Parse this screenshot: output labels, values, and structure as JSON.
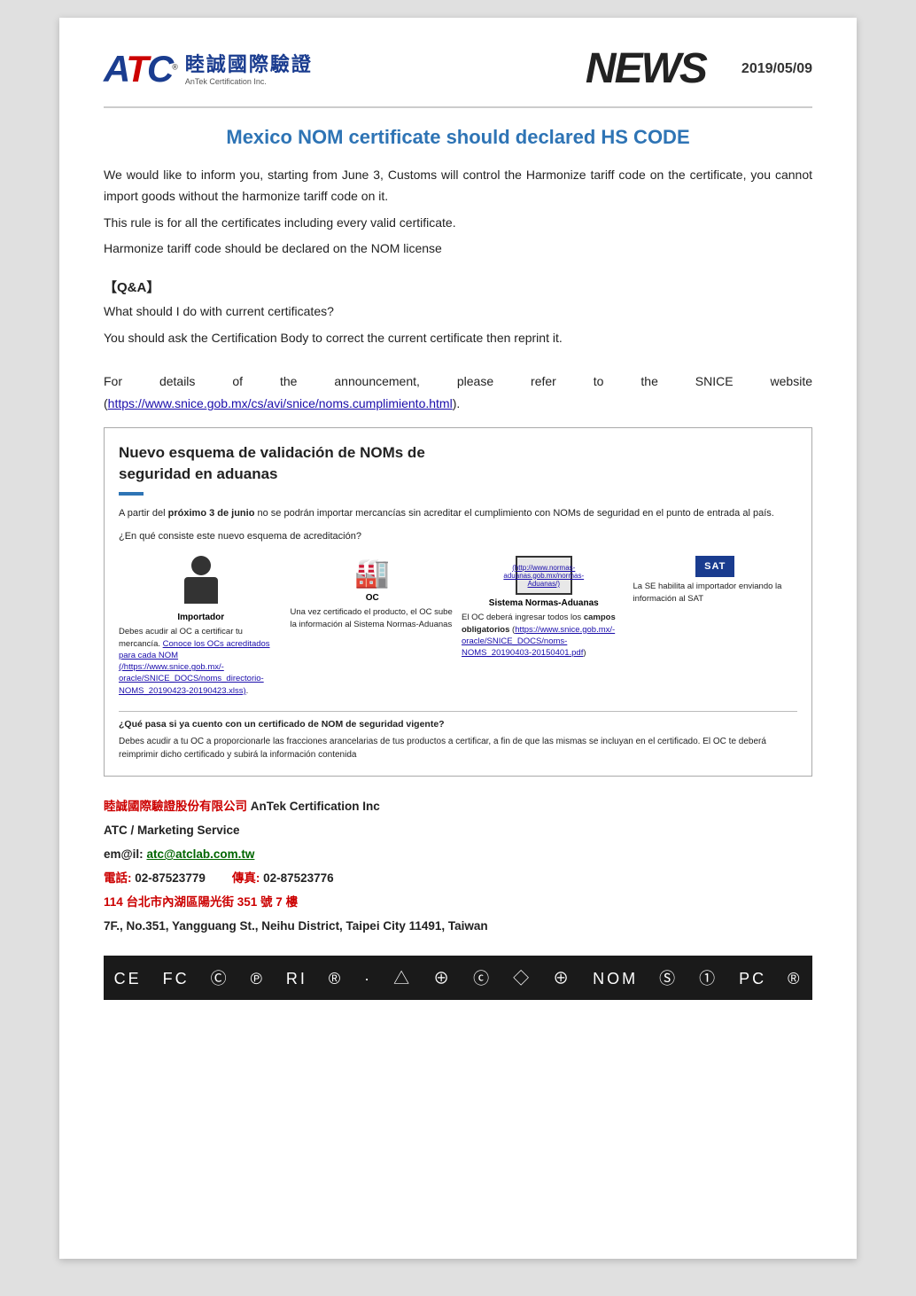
{
  "header": {
    "logo_atc": "ATC",
    "logo_cn": "睦誠國際驗證",
    "logo_sub": "AnTek Certification Inc.",
    "news": "NEWS",
    "date": "2019/05/09"
  },
  "main_title": "Mexico NOM certificate should declared HS CODE",
  "body": {
    "para1": "We would like to inform you, starting from June 3, Customs will control the Harmonize tariff code on the certificate, you cannot import goods without the harmonize tariff code on it.",
    "para2": "This rule is for all the certificates including every valid certificate.",
    "para3": "Harmonize tariff code should be declared on the NOM license",
    "qa_title": "【Q&A】",
    "qa_q": "What should I do with current certificates?",
    "qa_a": "You should ask the Certification Body to correct the current certificate then reprint it.",
    "ref_text": "For   details   of   the   announcement,   please   refer   to   the   SNICE   website",
    "ref_link_text": "https://www.snice.gob.mx/cs/avi/snice/noms.cumplimiento.html",
    "ref_link_url": "https://www.snice.gob.mx/cs/avi/snice/noms.cumplimiento.html"
  },
  "image_box": {
    "title_line1": "Nuevo esquema de validación de NOMs de",
    "title_line2": "seguridad en aduanas",
    "intro": "A partir del próximo 3 de junio no se podrán importar mercancías sin acreditar el cumplimiento con NOMs de seguridad en el punto de entrada al país.",
    "question": "¿En qué consiste este nuevo esquema de acreditación?",
    "importador_label": "Importador",
    "oc_label": "OC",
    "sistema_label": "Sistema Normas-Aduanas",
    "sat_label": "SAT",
    "col1_desc": "Debes acudir al OC a certificar tu mercancía. Conoce los OCs acreditados para cada NOM (/https://www.snice.gob.mx/-oracle/SNICE_DOCS/noms_directorio-NOMS_20190423-20190423.xlss).",
    "col2_desc_pre": "Una vez certificado el producto, el OC sube la información al Sistema Normas-Aduanas",
    "col3_desc_pre": "El OC deberá ingresar todos los campos obligatorios (https://www.snice.gob.mx/-oracle/SNICE_DOCS/noms-NOMS_20190403-20150401.pdf)",
    "col4_desc": "La SE habilita al importador enviando la información al SAT",
    "computer_link": "(http://www.normas-aduanas.gob.mx/normas-Aduanas/)",
    "bottom_q": "¿Qué pasa si ya cuento con un certificado de NOM de seguridad vigente?",
    "bottom_a": "Debes acudir a tu OC a proporcionarle las fracciones arancelarias de tus productos a certificar, a fin de que las mismas se incluyan en el certificado. El OC te deberá reimprimir dicho certificado y subirá la información contenida"
  },
  "footer": {
    "company_cn": "睦誠國際驗證股份有限公司",
    "company_en": "AnTek Certification Inc",
    "dept": "ATC / Marketing Service",
    "email_label": "em@il:",
    "email": "atc@atclab.com.tw",
    "tel_label": "電話:",
    "tel": "02-87523779",
    "fax_label": "傳真:",
    "fax": "02-87523776",
    "address_cn": "114 台北市內湖區陽光街 351 號 7 樓",
    "address_en": "7F., No.351, Yangguang St., Neihu District, Taipei City 11491, Taiwan"
  },
  "cert_logos": "CE FC C ® RI ® · △ d (cc) ◇ ⊕ NOM S ① PC ®"
}
